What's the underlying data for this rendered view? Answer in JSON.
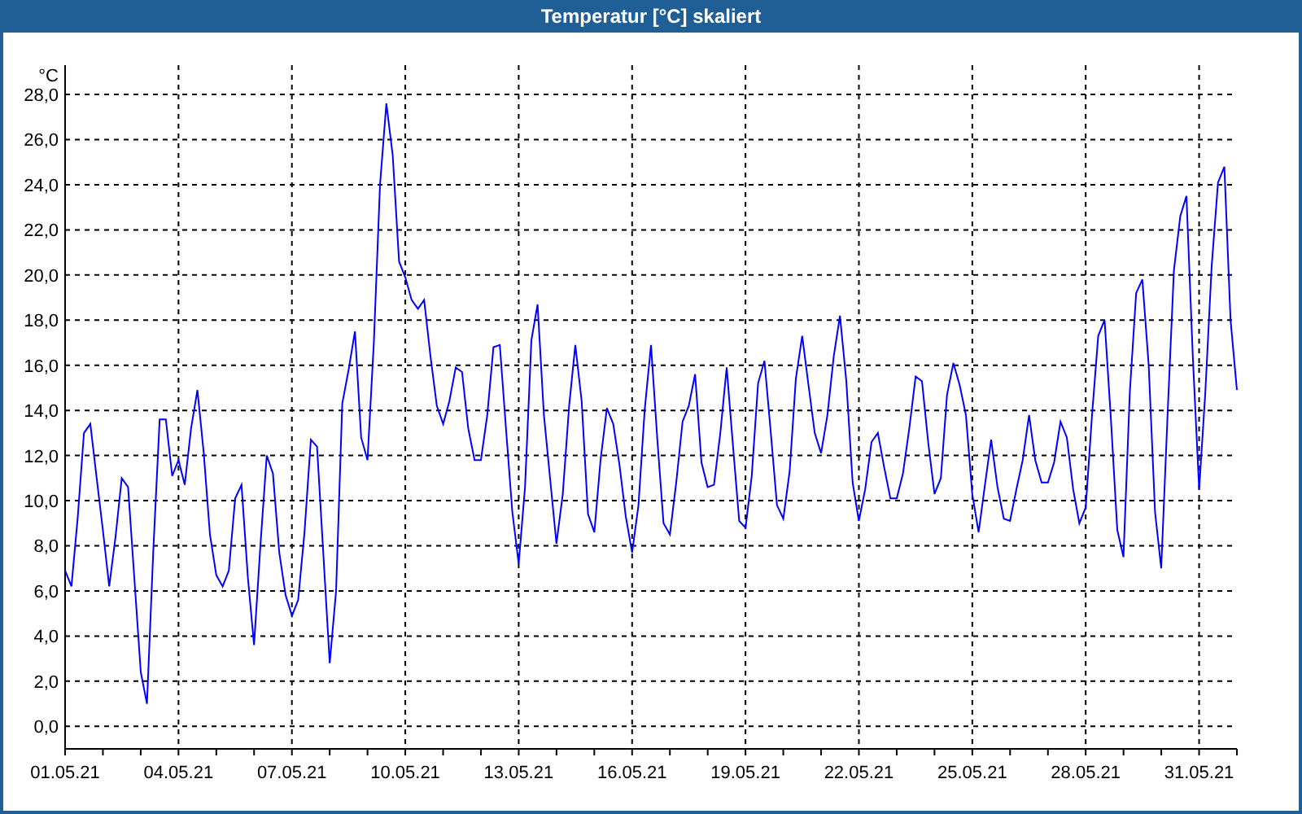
{
  "window": {
    "title": "Temperatur [°C] skaliert"
  },
  "chart": {
    "chart_data": {
      "type": "line",
      "ylabel": "°C",
      "categories": [
        "01.05.21",
        null,
        null,
        null,
        null,
        null,
        null,
        null,
        null,
        null,
        null,
        null,
        null,
        null,
        null,
        null,
        null,
        null,
        "04.05.21",
        null,
        null,
        null,
        null,
        null,
        null,
        null,
        null,
        null,
        null,
        null,
        null,
        null,
        null,
        null,
        null,
        null,
        "07.05.21",
        null,
        null,
        null,
        null,
        null,
        null,
        null,
        null,
        null,
        null,
        null,
        null,
        null,
        null,
        null,
        null,
        null,
        "10.05.21",
        null,
        null,
        null,
        null,
        null,
        null,
        null,
        null,
        null,
        null,
        null,
        null,
        null,
        null,
        null,
        null,
        null,
        "13.05.21",
        null,
        null,
        null,
        null,
        null,
        null,
        null,
        null,
        null,
        null,
        null,
        null,
        null,
        null,
        null,
        null,
        null,
        "16.05.21",
        null,
        null,
        null,
        null,
        null,
        null,
        null,
        null,
        null,
        null,
        null,
        null,
        null,
        null,
        null,
        null,
        null,
        "19.05.21",
        null,
        null,
        null,
        null,
        null,
        null,
        null,
        null,
        null,
        null,
        null,
        null,
        null,
        null,
        null,
        null,
        null,
        "22.05.21",
        null,
        null,
        null,
        null,
        null,
        null,
        null,
        null,
        null,
        null,
        null,
        null,
        null,
        null,
        null,
        null,
        null,
        "25.05.21",
        null,
        null,
        null,
        null,
        null,
        null,
        null,
        null,
        null,
        null,
        null,
        null,
        null,
        null,
        null,
        null,
        null,
        "28.05.21",
        null,
        null,
        null,
        null,
        null,
        null,
        null,
        null,
        null,
        null,
        null,
        null,
        null,
        null,
        null,
        null,
        null,
        "31.05.21",
        null,
        null,
        null,
        null,
        null,
        null
      ],
      "series": [
        {
          "color": "#0000ff",
          "values": [
            6.9,
            6.2,
            9.2,
            13.0,
            13.4,
            11.0,
            8.7,
            6.2,
            8.4,
            11.0,
            10.6,
            6.5,
            2.4,
            1.0,
            7.8,
            13.6,
            13.6,
            11.1,
            11.8,
            10.7,
            13.2,
            14.9,
            12.1,
            8.5,
            6.7,
            6.2,
            6.9,
            10.1,
            10.7,
            6.6,
            3.6,
            8.0,
            12.0,
            11.2,
            7.7,
            5.8,
            4.9,
            5.6,
            8.6,
            12.7,
            12.4,
            7.6,
            2.8,
            6.0,
            14.3,
            15.8,
            17.5,
            12.8,
            11.8,
            17.0,
            24.0,
            27.6,
            25.3,
            20.6,
            19.9,
            18.9,
            18.5,
            18.9,
            16.4,
            14.2,
            13.4,
            14.4,
            15.9,
            15.7,
            13.2,
            11.8,
            11.8,
            13.8,
            16.8,
            16.9,
            13.1,
            9.5,
            7.2,
            10.6,
            17.1,
            18.7,
            13.8,
            10.9,
            8.1,
            10.3,
            14.2,
            16.9,
            14.4,
            9.4,
            8.6,
            11.8,
            14.1,
            13.4,
            11.6,
            9.3,
            7.7,
            9.8,
            14.0,
            16.9,
            12.7,
            9.0,
            8.5,
            10.8,
            13.5,
            14.2,
            15.6,
            11.7,
            10.6,
            10.7,
            13.0,
            15.9,
            12.5,
            9.1,
            8.8,
            11.1,
            15.2,
            16.2,
            13.1,
            9.8,
            9.2,
            11.3,
            15.4,
            17.3,
            15.1,
            13.0,
            12.1,
            13.8,
            16.4,
            18.2,
            15.3,
            10.8,
            9.1,
            10.5,
            12.6,
            13.0,
            11.5,
            10.1,
            10.1,
            11.2,
            13.2,
            15.5,
            15.3,
            12.6,
            10.3,
            11.0,
            14.7,
            16.1,
            15.1,
            13.8,
            10.3,
            8.6,
            10.7,
            12.7,
            10.6,
            9.2,
            9.1,
            10.5,
            11.8,
            13.8,
            11.8,
            10.8,
            10.8,
            11.7,
            13.5,
            12.8,
            10.5,
            9.0,
            9.7,
            13.8,
            17.3,
            18.0,
            13.6,
            8.7,
            7.5,
            14.8,
            19.2,
            19.8,
            16.0,
            9.5,
            7.0,
            13.8,
            20.2,
            22.6,
            23.5,
            16.4,
            10.5,
            14.8,
            20.4,
            24.1,
            24.8,
            18.0,
            14.9
          ]
        }
      ],
      "grid": true,
      "ylim": [
        -1,
        29.3
      ],
      "yticks": [
        {
          "value": 0,
          "label": "0,0"
        },
        {
          "value": 2,
          "label": "2,0"
        },
        {
          "value": 4,
          "label": "4,0"
        },
        {
          "value": 6,
          "label": "6,0"
        },
        {
          "value": 8,
          "label": "8,0"
        },
        {
          "value": 10,
          "label": "10,0"
        },
        {
          "value": 12,
          "label": "12,0"
        },
        {
          "value": 14,
          "label": "14,0"
        },
        {
          "value": 16,
          "label": "16,0"
        },
        {
          "value": 18,
          "label": "18,0"
        },
        {
          "value": 20,
          "label": "20,0"
        },
        {
          "value": 22,
          "label": "22,0"
        },
        {
          "value": 24,
          "label": "24,0"
        },
        {
          "value": 26,
          "label": "26,0"
        },
        {
          "value": 28,
          "label": "28,0"
        }
      ]
    }
  }
}
